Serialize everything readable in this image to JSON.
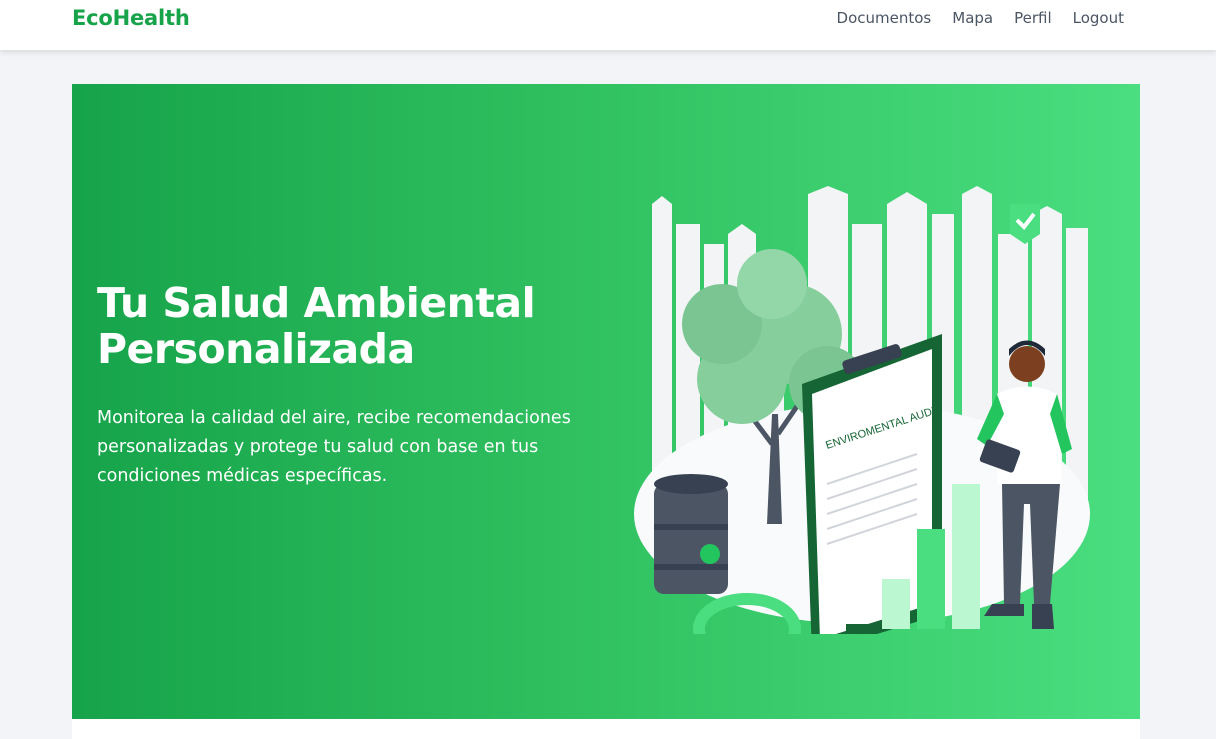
{
  "navbar": {
    "brand": "EcoHealth",
    "links": [
      "Documentos",
      "Mapa",
      "Perfil",
      "Logout"
    ]
  },
  "hero": {
    "title_line1": "Tu Salud Ambiental",
    "title_line2": "Personalizada",
    "subtitle": "Monitorea la calidad del aire, recibe recomendaciones personalizadas y protege tu salud con base en tus condiciones médicas específicas.",
    "illustration_text": "ENVIROMENTAL AUDIT"
  },
  "colors": {
    "brand": "#16a34a",
    "hero_start": "#16a34a",
    "hero_end": "#4ade80"
  },
  "icons": [
    "check-shield-icon",
    "biohazard-icon",
    "magnifier-icon"
  ]
}
